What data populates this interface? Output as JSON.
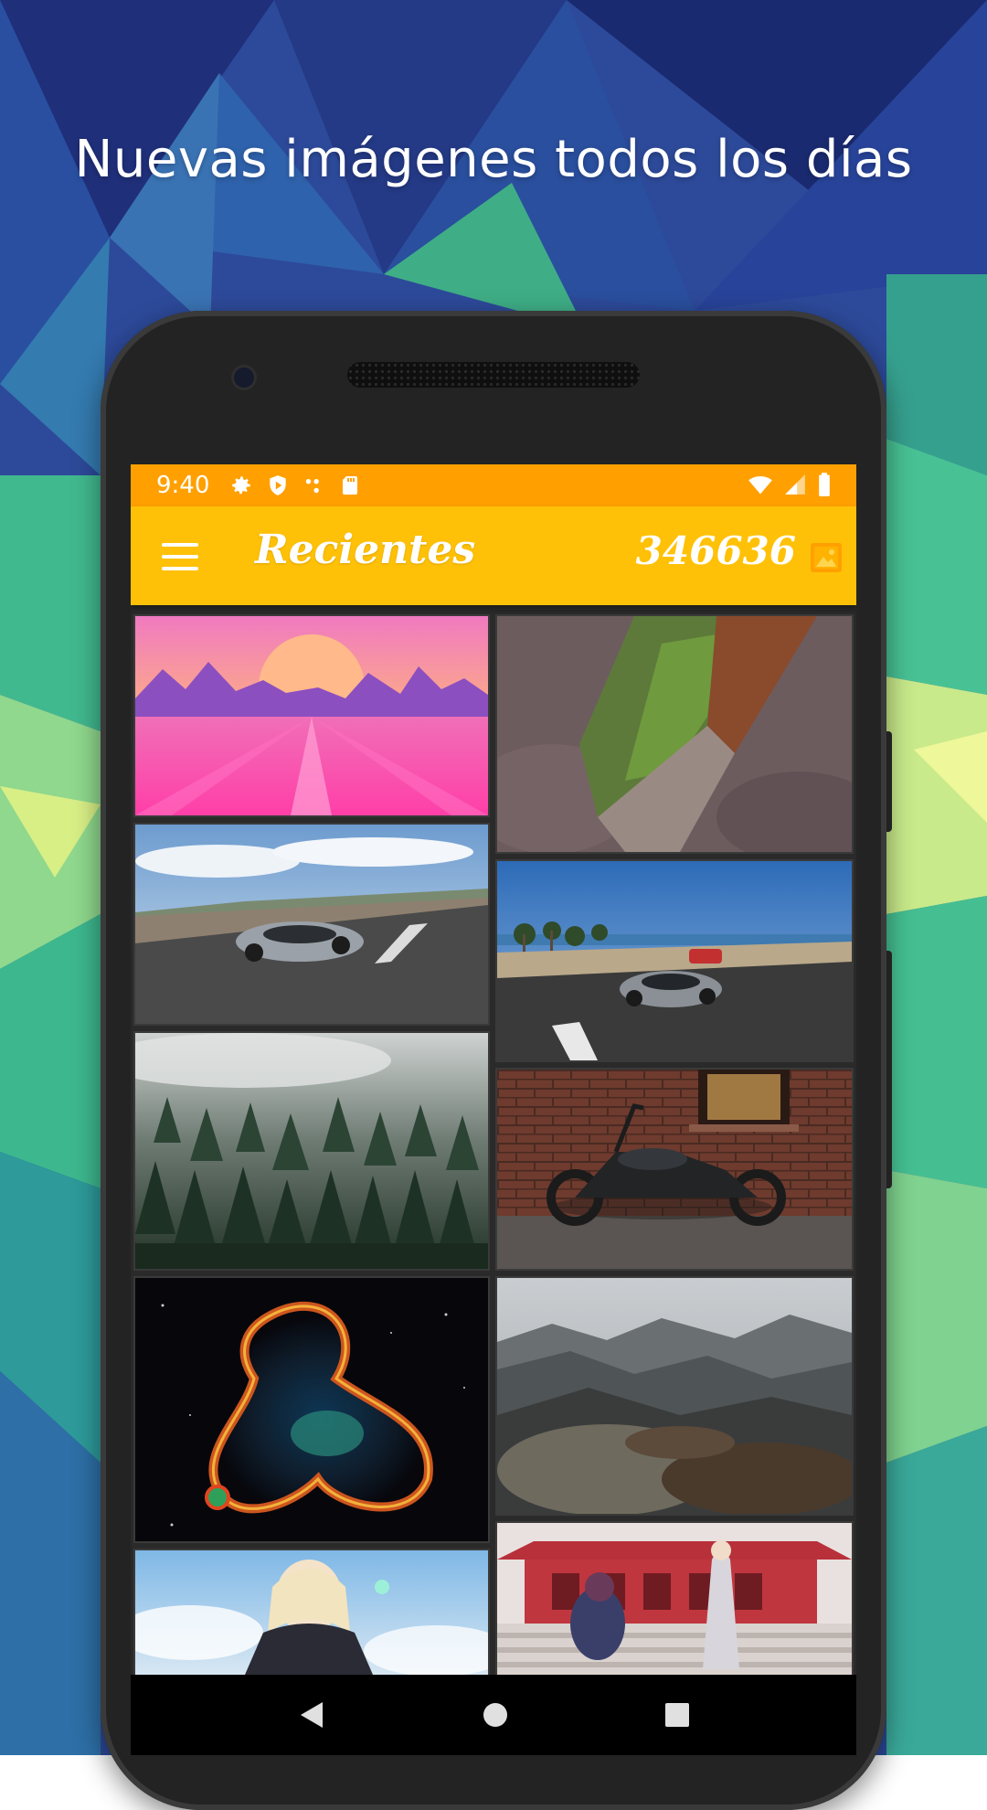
{
  "promo": {
    "headline": "Nuevas imágenes todos los días"
  },
  "statusbar": {
    "time": "9:40",
    "icons_left": [
      "settings-icon",
      "shield-play-icon",
      "dots-icon",
      "sd-card-icon"
    ],
    "icons_right": [
      "wifi-icon",
      "signal-icon",
      "battery-icon"
    ]
  },
  "appbar": {
    "title": "Recientes",
    "count": "346636",
    "menu_icon": "hamburger-menu-icon",
    "count_icon": "image-icon"
  },
  "colors": {
    "statusbar": "#ffa000",
    "appbar": "#ffc107",
    "screen_bg": "#2a2a2a"
  },
  "gallery": {
    "left_column": [
      {
        "name": "tile-synthwave-sunset"
      },
      {
        "name": "tile-silver-supercar-road"
      },
      {
        "name": "tile-misty-pine-forest"
      },
      {
        "name": "tile-nebula-space"
      },
      {
        "name": "tile-anime-girl-sky"
      }
    ],
    "right_column": [
      {
        "name": "tile-moss-tree-trunk"
      },
      {
        "name": "tile-supercar-coastal-road"
      },
      {
        "name": "tile-motorcycle-brick-wall"
      },
      {
        "name": "tile-rocky-mountains"
      },
      {
        "name": "tile-anime-temple"
      }
    ]
  },
  "navbar": {
    "back": "back-icon",
    "home": "home-icon",
    "recents": "recents-icon"
  }
}
